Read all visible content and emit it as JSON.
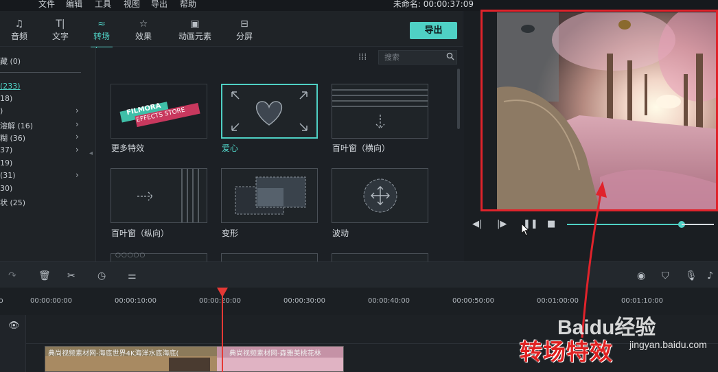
{
  "menubar": {
    "items": [
      "文件",
      "编辑",
      "工具",
      "视图",
      "导出",
      "帮助"
    ],
    "project_title": "未命名: 00:00:37:09"
  },
  "tabs": [
    {
      "label": "音频",
      "icon": "music-note-icon"
    },
    {
      "label": "文字",
      "icon": "text-icon"
    },
    {
      "label": "转场",
      "icon": "transition-icon",
      "active": true
    },
    {
      "label": "效果",
      "icon": "effects-icon"
    },
    {
      "label": "动画元素",
      "icon": "elements-icon"
    },
    {
      "label": "分屏",
      "icon": "split-screen-icon"
    }
  ],
  "export_label": "导出",
  "search": {
    "placeholder": "搜索"
  },
  "categories": [
    {
      "label": "藏 (0)"
    },
    {
      "label": "(233)",
      "selected": true
    },
    {
      "label": "18)"
    },
    {
      "label": ")"
    },
    {
      "label": "溶解 (16)"
    },
    {
      "label": "糊 (36)"
    },
    {
      "label": "37)"
    },
    {
      "label": "19)"
    },
    {
      "label": " (31)"
    },
    {
      "label": "30)"
    },
    {
      "label": "状 (25)"
    }
  ],
  "transitions": [
    {
      "label": "更多特效",
      "thumb_text_1": "FILMORA",
      "thumb_text_2": "EFFECTS STORE"
    },
    {
      "label": "爱心",
      "selected": true
    },
    {
      "label": "百叶窗（横向）"
    },
    {
      "label": "百叶窗（纵向）"
    },
    {
      "label": "变形"
    },
    {
      "label": "波动"
    }
  ],
  "playback": {
    "progress": 0.78
  },
  "ruler_ticks": [
    "00:00:00:00",
    "00:00:10:00",
    "00:00:20:00",
    "00:00:30:00",
    "00:00:40:00",
    "00:00:50:00",
    "00:01:00:00",
    "00:01:10:00"
  ],
  "clips": [
    {
      "title": "典尚视频素材网-海底世界4K海洋水底海底("
    },
    {
      "title": "典尚视频素材网-森雅美桃花林"
    }
  ],
  "annotation": "转场特效",
  "watermark": {
    "brand": "Baidu经验",
    "url": "jingyan.baidu.com"
  },
  "colors": {
    "accent": "#4fd1c5",
    "highlight": "#e0232b",
    "playhead": "#e53935"
  }
}
